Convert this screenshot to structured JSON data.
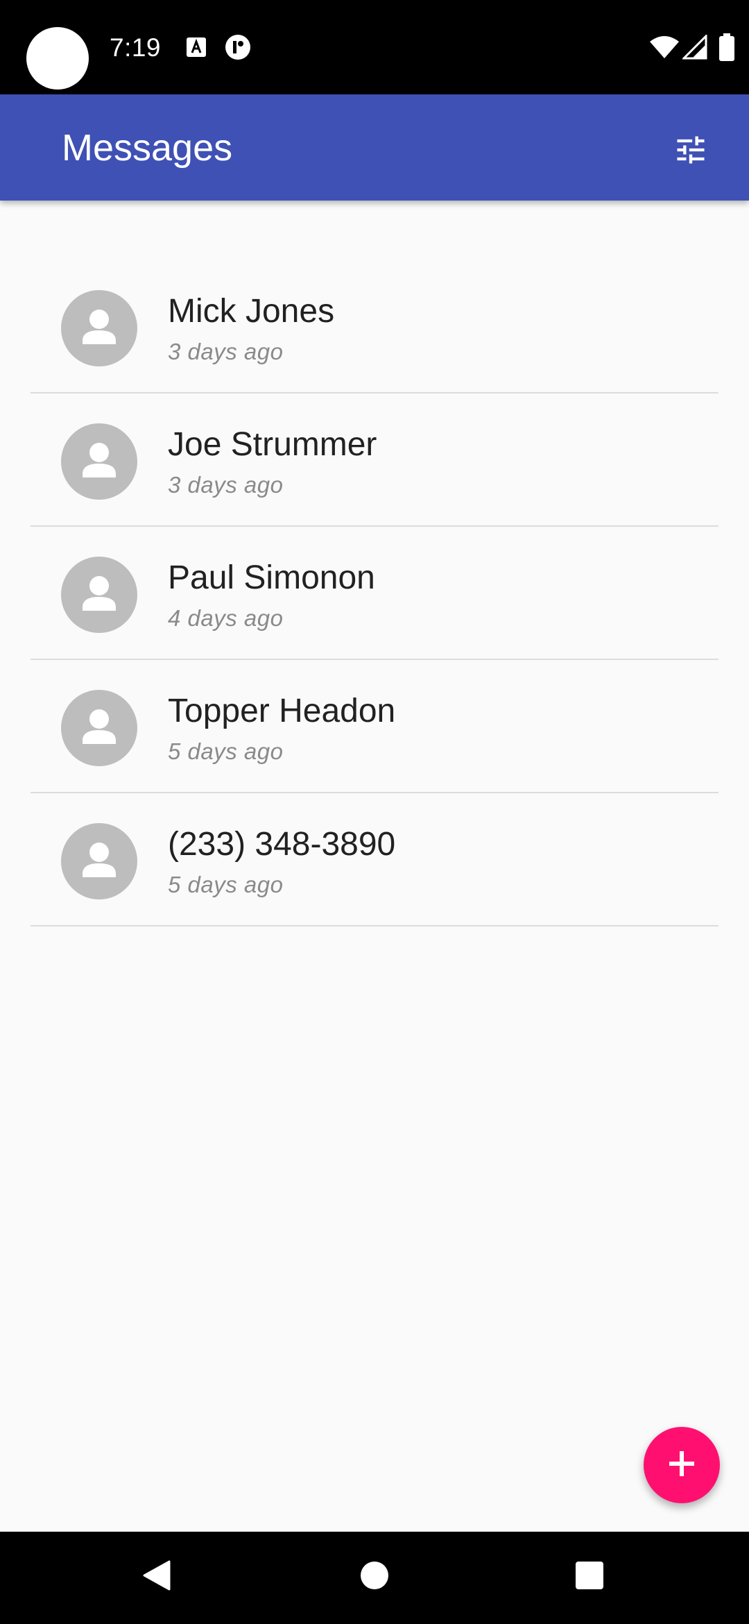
{
  "status_bar": {
    "time": "7:19",
    "icons": [
      "camera-cutout",
      "accessibility-a-icon",
      "data-saver-icon",
      "wifi-icon",
      "cell-signal-icon",
      "battery-icon"
    ]
  },
  "app_bar": {
    "title": "Messages",
    "action_icon": "tune-filter-icon"
  },
  "conversations": [
    {
      "name": "Mick Jones",
      "time": "3 days ago"
    },
    {
      "name": "Joe Strummer",
      "time": "3 days ago"
    },
    {
      "name": "Paul Simonon",
      "time": "4 days ago"
    },
    {
      "name": "Topper Headon",
      "time": "5 days ago"
    },
    {
      "name": "(233) 348-3890",
      "time": "5 days ago"
    }
  ],
  "fab": {
    "icon": "add-icon"
  },
  "nav_bar": {
    "icons": [
      "back-icon",
      "home-icon",
      "recents-icon"
    ]
  },
  "colors": {
    "app_bar": "#3f51b5",
    "fab": "#ff1070",
    "avatar": "#bdbdbd",
    "background": "#fafafa"
  }
}
